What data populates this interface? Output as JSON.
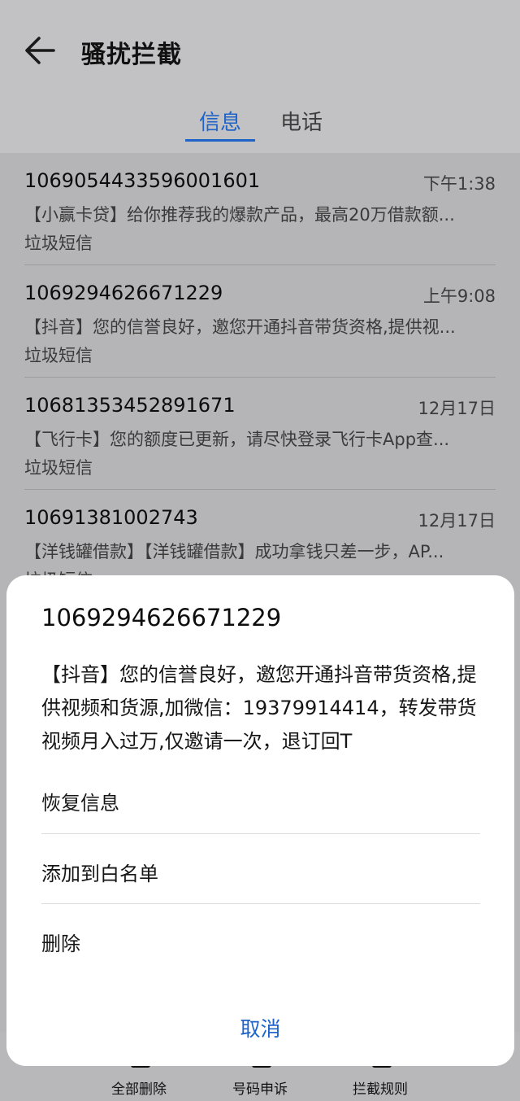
{
  "header": {
    "title": "骚扰拦截",
    "tabs": [
      {
        "label": "信息"
      },
      {
        "label": "电话"
      }
    ]
  },
  "messages": [
    {
      "number": "1069054433596001601",
      "time": "下午1:38",
      "preview": "【小赢卡贷】给你推荐我的爆款产品，最高20万借款额...",
      "tag": "垃圾短信"
    },
    {
      "number": "1069294626671229",
      "time": "上午9:08",
      "preview": "【抖音】您的信誉良好，邀您开通抖音带货资格,提供视...",
      "tag": "垃圾短信"
    },
    {
      "number": "10681353452891671",
      "time": "12月17日",
      "preview": "【飞行卡】您的额度已更新，请尽快登录飞行卡App查...",
      "tag": "垃圾短信"
    },
    {
      "number": "10691381002743",
      "time": "12月17日",
      "preview": "【洋钱罐借款】【洋钱罐借款】成功拿钱只差一步，AP...",
      "tag": "垃圾短信"
    }
  ],
  "bottom_bar": [
    {
      "label": "全部删除"
    },
    {
      "label": "号码申诉"
    },
    {
      "label": "拦截规则"
    }
  ],
  "sheet": {
    "number": "1069294626671229",
    "body": "【抖音】您的信誉良好，邀您开通抖音带货资格,提供视频和货源,加微信：19379914414，转发带货视频月入过万,仅邀请一次，退订回T",
    "actions": [
      {
        "label": "恢复信息"
      },
      {
        "label": "添加到白名单"
      },
      {
        "label": "删除"
      }
    ],
    "cancel_label": "取消"
  },
  "colors": {
    "accent": "#1e63c8",
    "dim_overlay": "#b5b5b7",
    "sheet_bg": "#ffffff"
  },
  "icons": [
    "back-arrow-icon",
    "delete-all-icon",
    "appeal-icon",
    "rules-icon"
  ]
}
